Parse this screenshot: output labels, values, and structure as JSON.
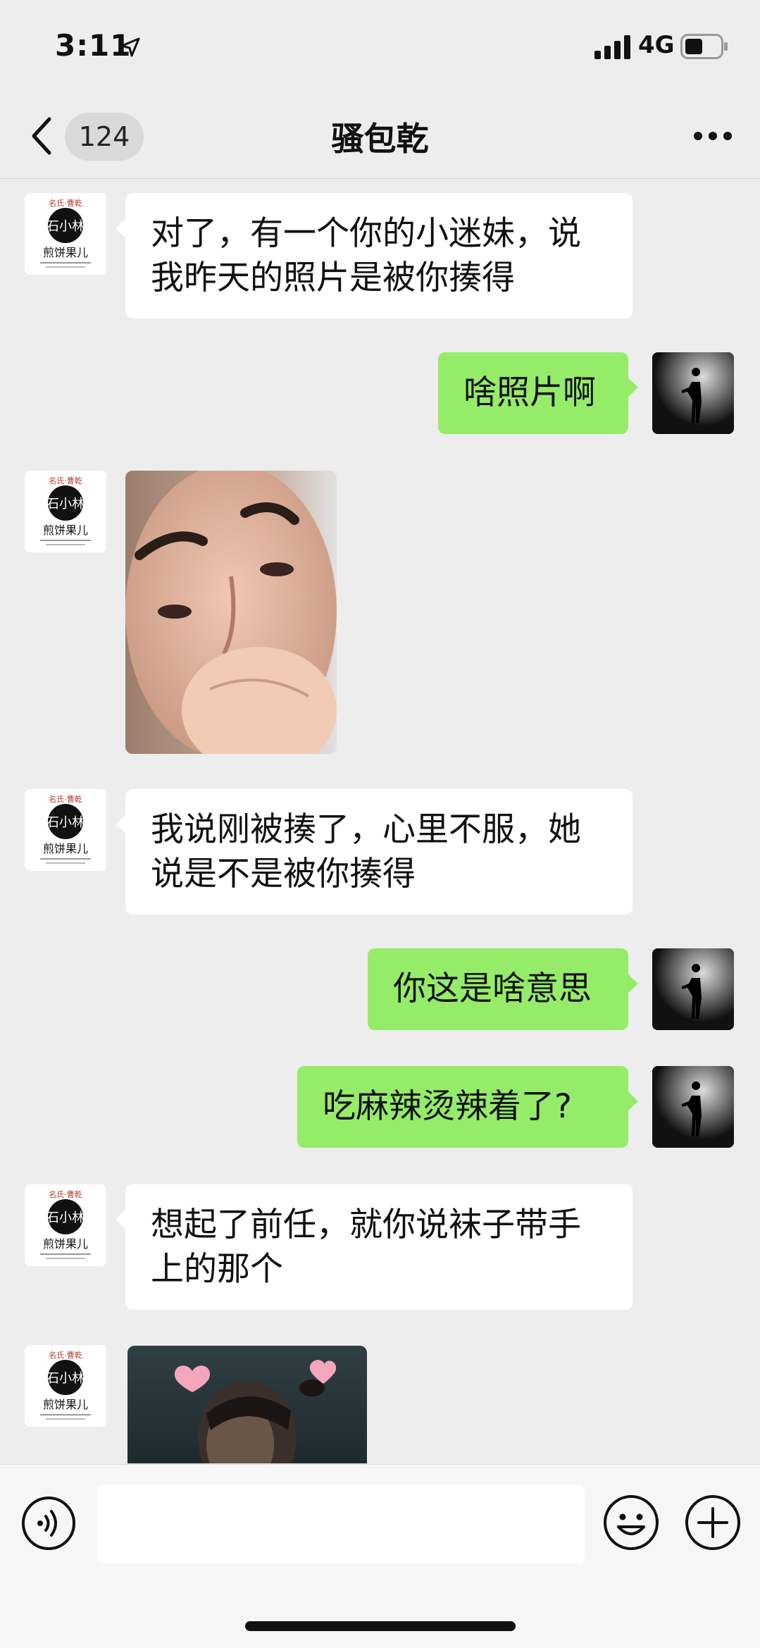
{
  "status_bar": {
    "time": "3:11",
    "network": "4G"
  },
  "nav": {
    "unread_count": "124",
    "title": "骚包乾"
  },
  "avatar_logo": {
    "top_text": "名氏·曹乾",
    "name": "煎饼果儿"
  },
  "messages": [
    {
      "side": "in",
      "type": "text",
      "text": "对了，有一个你的小迷妹，说我昨天的照片是被你揍得"
    },
    {
      "side": "out",
      "type": "text",
      "text": "啥照片啊"
    },
    {
      "side": "in",
      "type": "image",
      "icon": "selfie-photo"
    },
    {
      "side": "in",
      "type": "text",
      "text": "我说刚被揍了，心里不服，她说是不是被你揍得"
    },
    {
      "side": "out",
      "type": "text",
      "text": "你这是啥意思"
    },
    {
      "side": "out",
      "type": "text",
      "text": "吃麻辣烫辣着了?"
    },
    {
      "side": "in",
      "type": "text",
      "text": "想起了前任，就你说袜子带手上的那个"
    },
    {
      "side": "in",
      "type": "image",
      "icon": "sticker-hearts"
    }
  ],
  "colors": {
    "background": "#ededed",
    "outgoing_bubble": "#95ec69",
    "incoming_bubble": "#ffffff"
  },
  "input_bar": {
    "message_value": "",
    "icons": [
      "voice-icon",
      "emoji-icon",
      "plus-icon"
    ]
  }
}
